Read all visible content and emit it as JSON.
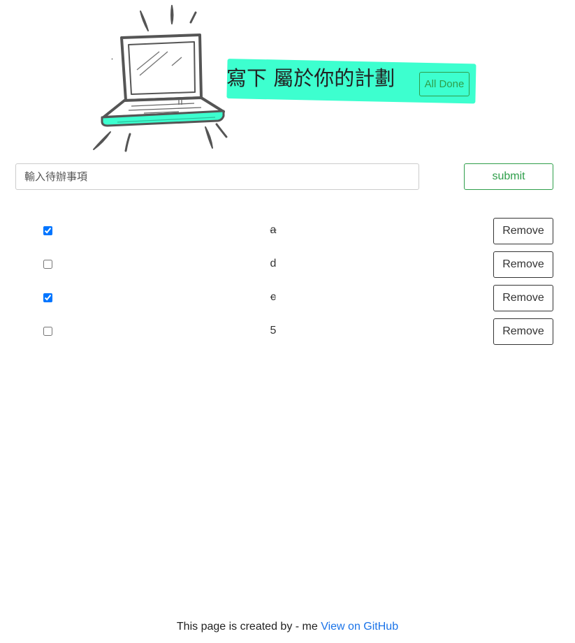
{
  "header": {
    "title": "寫下 屬於你的計劃",
    "all_done_label": "All Done"
  },
  "form": {
    "input_placeholder": "輸入待辦事項",
    "input_value": "",
    "submit_label": "submit"
  },
  "todos": [
    {
      "text": "a",
      "done": true,
      "remove_label": "Remove"
    },
    {
      "text": "d",
      "done": false,
      "remove_label": "Remove"
    },
    {
      "text": "c",
      "done": true,
      "remove_label": "Remove"
    },
    {
      "text": "5",
      "done": false,
      "remove_label": "Remove"
    }
  ],
  "footer": {
    "credit_text": "This page is created by - me",
    "link_label": "View on GitHub"
  },
  "colors": {
    "highlight": "#3dffcf",
    "accent_green": "#2e9e4a",
    "link_blue": "#1a73e8"
  },
  "icons": {
    "hero": "laptop-illustration-icon"
  }
}
